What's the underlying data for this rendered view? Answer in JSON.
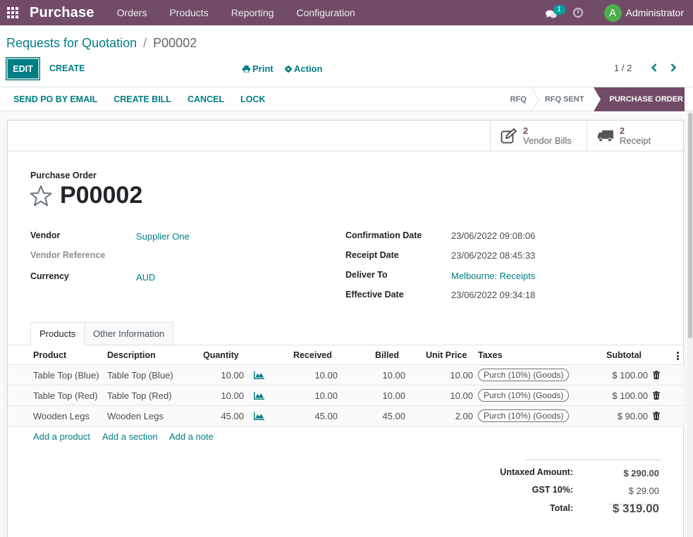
{
  "navbar": {
    "app_name": "Purchase",
    "menu": [
      "Orders",
      "Products",
      "Reporting",
      "Configuration"
    ],
    "chat_count": "1",
    "user_initial": "A",
    "user_name": "Administrator",
    "color": "#714b67"
  },
  "breadcrumb": {
    "parent": "Requests for Quotation",
    "separator": "/",
    "current": "P00002"
  },
  "toolbar": {
    "edit": "EDIT",
    "create": "CREATE",
    "print": "Print",
    "action": "Action",
    "pager": "1 / 2"
  },
  "statusbar": {
    "buttons": [
      "SEND PO BY EMAIL",
      "CREATE BILL",
      "CANCEL",
      "LOCK"
    ],
    "stages": [
      "RFQ",
      "RFQ SENT",
      "PURCHASE ORDER"
    ],
    "active_stage": "PURCHASE ORDER"
  },
  "smart_buttons": [
    {
      "value": "2",
      "label": "Vendor Bills",
      "icon": "pencil-square-icon"
    },
    {
      "value": "2",
      "label": "Receipt",
      "icon": "truck-icon"
    }
  ],
  "header": {
    "doc_type": "Purchase Order",
    "doc_name": "P00002"
  },
  "fields_left": [
    {
      "label": "Vendor",
      "value": "Supplier One"
    },
    {
      "label": "Vendor Reference",
      "value": ""
    },
    {
      "label": "Currency",
      "value": "AUD"
    }
  ],
  "fields_right": [
    {
      "label": "Confirmation Date",
      "value": "23/06/2022 09:08:06"
    },
    {
      "label": "Receipt Date",
      "value": "23/06/2022 08:45:33"
    },
    {
      "label": "Deliver To",
      "value": "Melbourne: Receipts"
    },
    {
      "label": "Effective Date",
      "value": "23/06/2022 09:34:18"
    }
  ],
  "tabs": [
    "Products",
    "Other Information"
  ],
  "table": {
    "columns": [
      "Product",
      "Description",
      "Quantity",
      "Received",
      "Billed",
      "Unit Price",
      "Taxes",
      "Subtotal"
    ],
    "rows": [
      {
        "product": "Table Top (Blue)",
        "description": "Table Top (Blue)",
        "quantity": "10.00",
        "received": "10.00",
        "billed": "10.00",
        "unit_price": "10.00",
        "taxes": "Purch (10%) (Goods)",
        "subtotal": "$ 100.00"
      },
      {
        "product": "Table Top (Red)",
        "description": "Table Top (Red)",
        "quantity": "10.00",
        "received": "10.00",
        "billed": "10.00",
        "unit_price": "10.00",
        "taxes": "Purch (10%) (Goods)",
        "subtotal": "$ 100.00"
      },
      {
        "product": "Wooden Legs",
        "description": "Wooden Legs",
        "quantity": "45.00",
        "received": "45.00",
        "billed": "45.00",
        "unit_price": "2.00",
        "taxes": "Purch (10%) (Goods)",
        "subtotal": "$ 90.00"
      }
    ],
    "add_links": [
      "Add a product",
      "Add a section",
      "Add a note"
    ]
  },
  "totals": {
    "untaxed_label": "Untaxed Amount:",
    "untaxed_value": "$ 290.00",
    "tax_label": "GST 10%:",
    "tax_value": "$ 29.00",
    "total_label": "Total:",
    "total_value": "$ 319.00"
  }
}
